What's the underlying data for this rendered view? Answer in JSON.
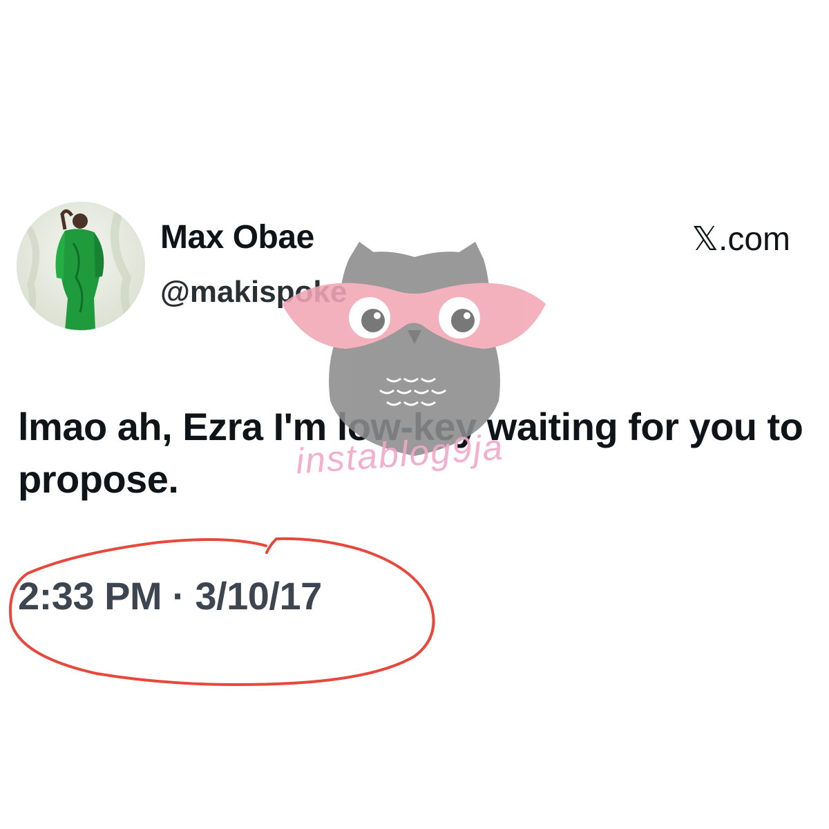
{
  "tweet": {
    "author": {
      "display_name": "Max Obae",
      "handle": "@makispoke",
      "avatar_icon": "profile-photo"
    },
    "source": "𝕏.com",
    "text": "lmao ah, Ezra I'm low-key waiting for you to propose.",
    "timestamp": "2:33 PM · 3/10/17"
  },
  "watermark": {
    "logo_icon": "owl-with-glasses-logo",
    "text": "instablog9ja",
    "colors": {
      "owl": "#8f8f8f",
      "glasses": "#f2a2b4",
      "text": "#f2a8c8"
    }
  },
  "annotation": {
    "type": "hand-drawn-circle",
    "color": "#e8473c"
  },
  "colors": {
    "text_primary": "#0f1419",
    "text_secondary": "#3d4650",
    "background": "#ffffff"
  }
}
